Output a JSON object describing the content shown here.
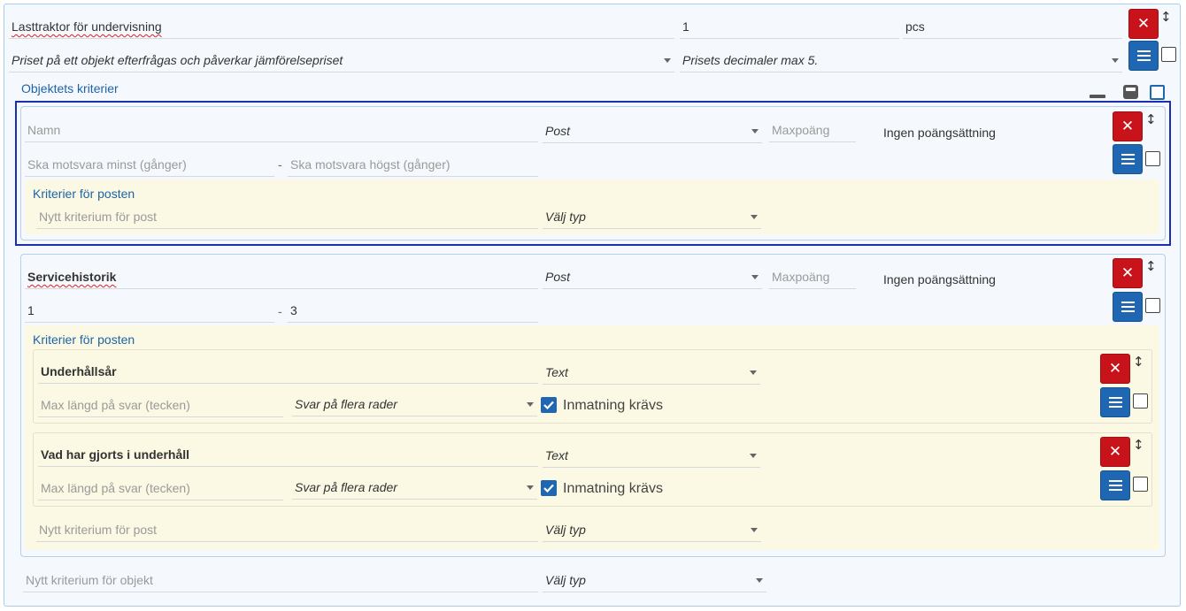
{
  "object": {
    "name": "Lasttraktor för undervisning",
    "quantity": "1",
    "unit": "pcs",
    "price_mode": "Priset på ett objekt efterfrågas och påverkar jämförelsepriset",
    "price_decimals": "Prisets decimaler max 5.",
    "criteria_label": "Objektets kriterier",
    "new_criterion_placeholder": "Nytt kriterium för objekt",
    "new_criterion_type": "Välj typ"
  },
  "post1": {
    "name_placeholder": "Namn",
    "type": "Post",
    "maxpoints_placeholder": "Maxpoäng",
    "scoring": "Ingen poängsättning",
    "min_placeholder": "Ska motsvara minst (gånger)",
    "max_placeholder": "Ska motsvara högst (gånger)",
    "separator": "-",
    "criteria_label": "Kriterier för posten",
    "new_criterion_placeholder": "Nytt kriterium för post",
    "new_criterion_type": "Välj typ"
  },
  "post2": {
    "name": "Servicehistorik",
    "type": "Post",
    "maxpoints_placeholder": "Maxpoäng",
    "scoring": "Ingen poängsättning",
    "min": "1",
    "max": "3",
    "separator": "-",
    "criteria_label": "Kriterier för posten",
    "new_criterion_placeholder": "Nytt kriterium för post",
    "new_criterion_type": "Välj typ",
    "criteria": [
      {
        "name": "Underhållsår",
        "type": "Text",
        "maxlen_placeholder": "Max längd på svar (tecken)",
        "answer_mode": "Svar på flera rader",
        "required_label": "Inmatning krävs",
        "required": true
      },
      {
        "name": "Vad har gjorts i underhåll",
        "type": "Text",
        "maxlen_placeholder": "Max längd på svar (tecken)",
        "answer_mode": "Svar på flera rader",
        "required_label": "Inmatning krävs",
        "required": true
      }
    ]
  },
  "icons": {
    "delete": "close-icon",
    "menu": "hamburger-menu-icon",
    "reorder": "up-down-arrow-icon",
    "collapse": "minimize-icon",
    "save": "save-icon"
  },
  "colors": {
    "delete_button": "#c9131b",
    "menu_button": "#1f66b3",
    "link_text": "#1c64a8",
    "selection_border": "#1a2fb0",
    "post_criteria_background": "#fbf8e3"
  }
}
